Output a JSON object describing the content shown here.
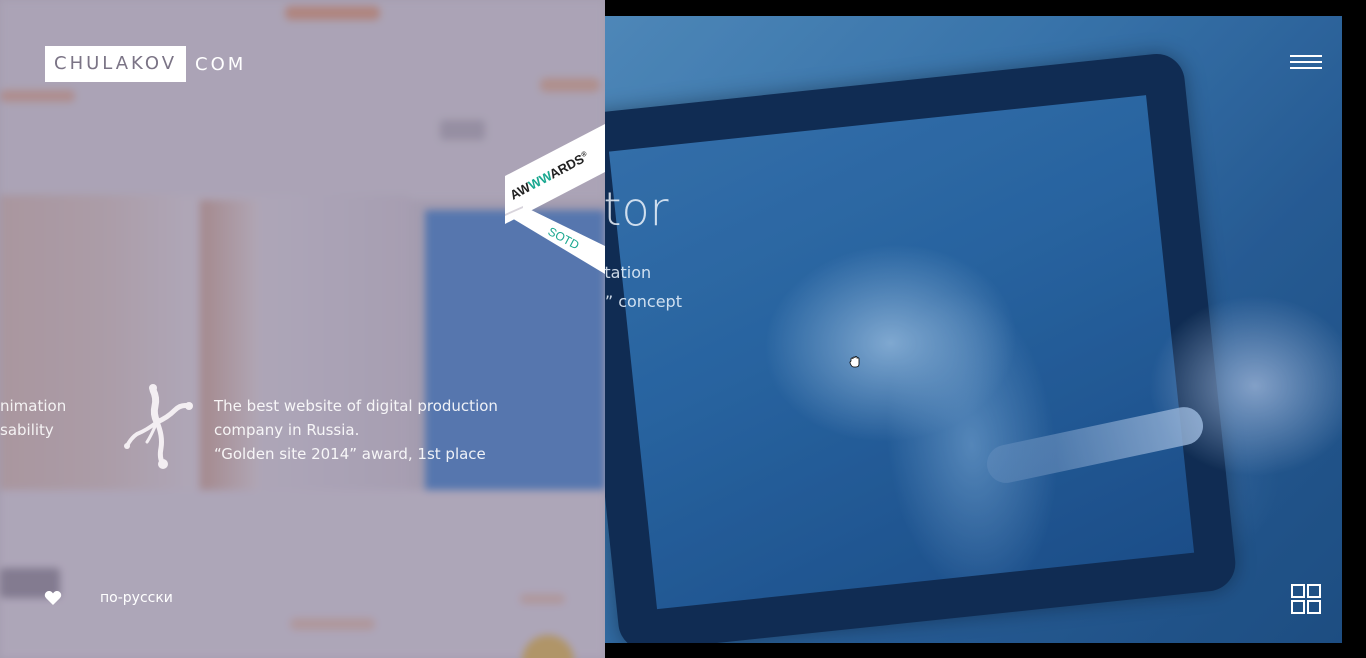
{
  "logo": {
    "box_text": "CHULAKOV",
    "rest_text": "COM"
  },
  "slide": {
    "title": "octor",
    "subtitle_line1": "resentation",
    "subtitle_line2": "hcare” concept"
  },
  "left_panel": {
    "fragment_line1": "nimation",
    "fragment_line2": "sability",
    "award": {
      "line1": "The best website of digital production",
      "line2": "company in Russia.",
      "line3": "“Golden site 2014” award, 1st place"
    }
  },
  "footer": {
    "language_link": "по-русски"
  },
  "ribbon": {
    "brand_part1": "AW",
    "brand_part2": "WW",
    "brand_part3": "ARDS",
    "registered_mark": "®",
    "badge": "SOTD"
  },
  "icons": {
    "menu": "hamburger-menu-icon",
    "grid": "grid-view-icon",
    "heart": "heart-icon",
    "award": "dancing-figure-icon",
    "cursor": "hand-grab-cursor"
  },
  "colors": {
    "ribbon_accent": "#1aa890",
    "left_tint": "#7a708c",
    "photo_blue": "#3f7cb0"
  }
}
